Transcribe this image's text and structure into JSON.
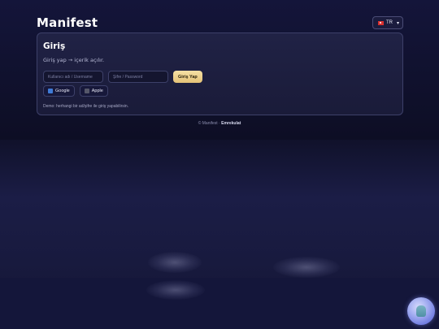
{
  "header": {
    "brand": "Manifest",
    "language": {
      "code": "TR",
      "flag_icon": "turkey-flag-icon"
    }
  },
  "login_card": {
    "title": "Giriş",
    "subtitle": "Giriş yap → içerik açılır.",
    "username_placeholder": "Kullanıcı adı / Username",
    "password_placeholder": "Şifre / Password",
    "login_button": "Giriş Yap",
    "google_button": "Google",
    "apple_button": "Apple",
    "demo_note": "Demo: herhangi bir ad/şifre ile giriş yapabilirsin."
  },
  "footer": {
    "prefix": "© Manifest · ",
    "author": "Emrekulat"
  },
  "colors": {
    "accent_gold": "#e9c983",
    "background": "#12132e",
    "card": "#1d1f40"
  },
  "assistant_button": {
    "icon": "assistant-avatar-icon"
  }
}
